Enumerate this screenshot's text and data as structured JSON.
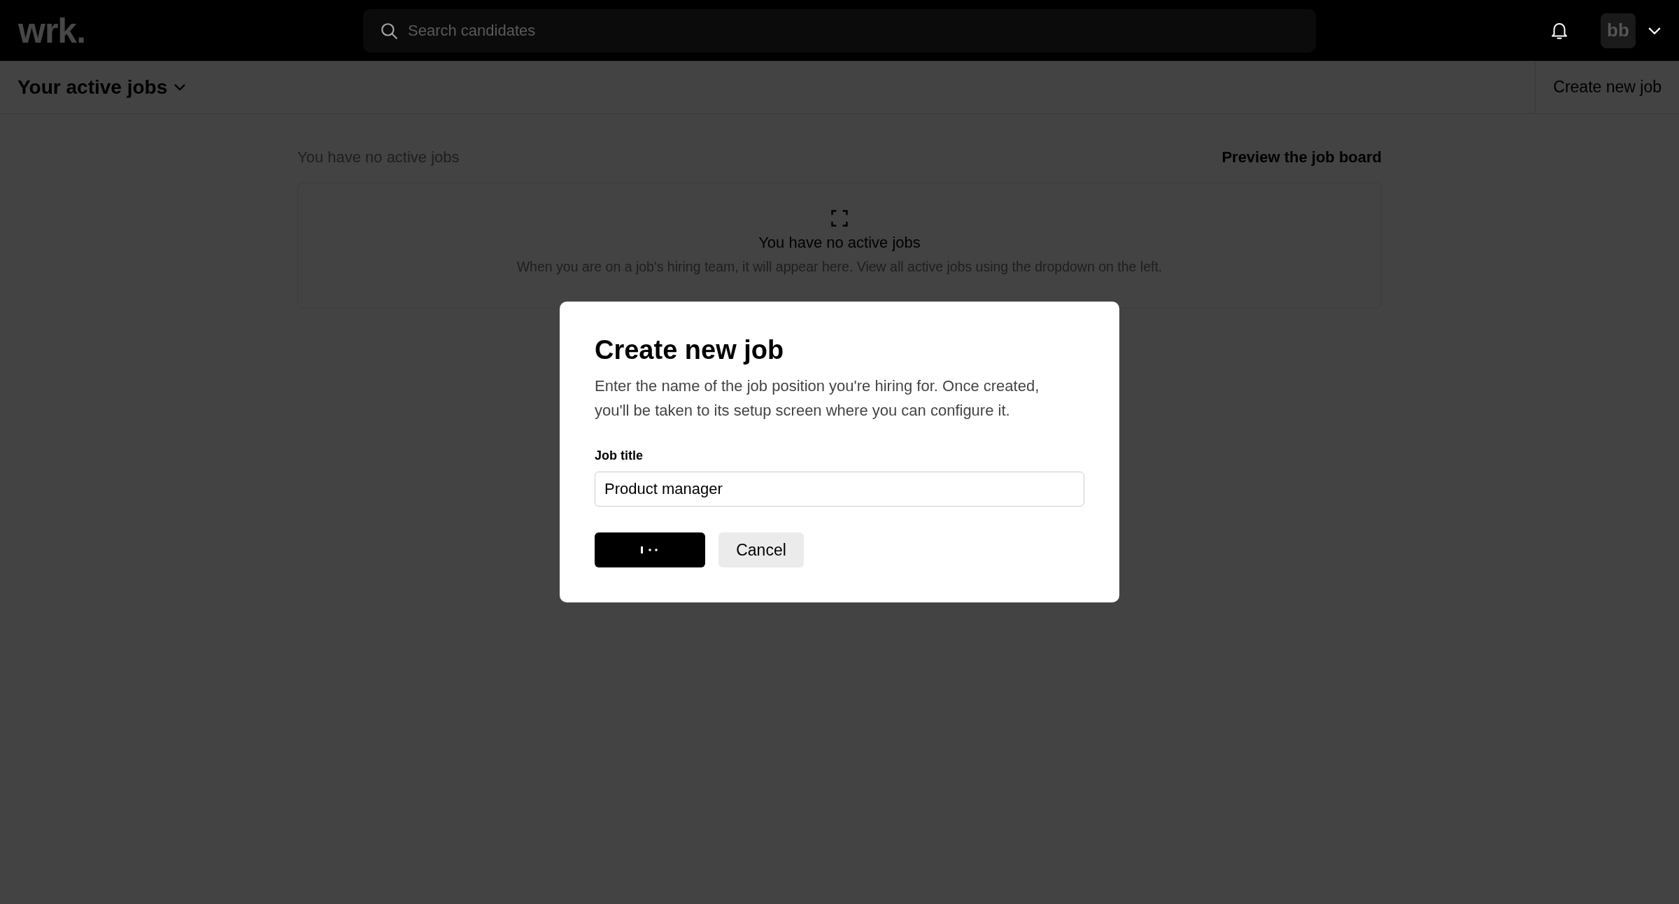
{
  "top_bar": {
    "logo": "wrk.",
    "search": {
      "placeholder": "Search candidates"
    },
    "avatar": {
      "initials": "bb"
    }
  },
  "header": {
    "title": "Your active jobs",
    "action": "Create new job"
  },
  "jobs": {
    "caption": "You have no active jobs",
    "link": "Preview the job board",
    "empty_state": {
      "title": "You have no active jobs",
      "message": "When you are on a job's hiring team, it will appear here. View all active jobs using the dropdown on the left."
    }
  },
  "dialog": {
    "title": "Create new job",
    "description": "Enter the name of the job position you're hiring for. Once created, you'll be taken to its setup screen where you can configure it.",
    "field": {
      "label": "Job title",
      "value": "Product manager"
    },
    "buttons": [
      {
        "kind": "primary",
        "loading": true
      },
      {
        "kind": "secondary",
        "label": "Cancel",
        "loading": false
      }
    ]
  }
}
